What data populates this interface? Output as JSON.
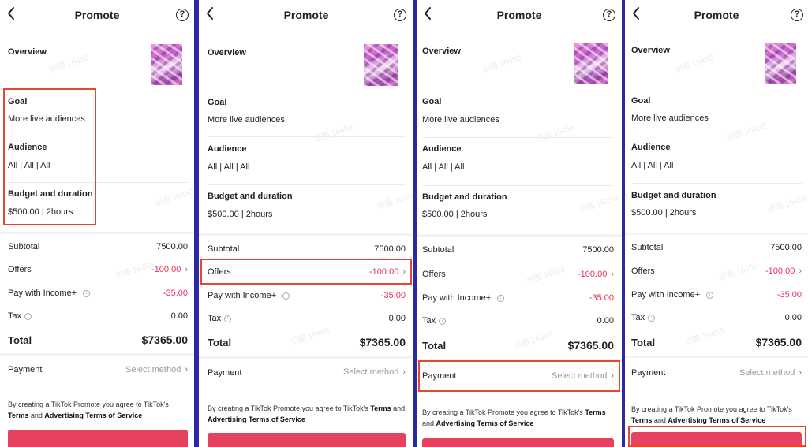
{
  "header": {
    "title": "Promote",
    "help_icon": "?"
  },
  "overview_label": "Overview",
  "goal": {
    "label": "Goal",
    "value": "More live audiences"
  },
  "audience": {
    "label": "Audience",
    "value": "All | All | All"
  },
  "budget": {
    "label": "Budget and duration",
    "value": "$500.00 | 2hours"
  },
  "summary": {
    "subtotal_label": "Subtotal",
    "subtotal_value": "7500.00",
    "offers_label": "Offers",
    "offers_value": "-100.00",
    "income_label": "Pay with Income+",
    "income_value": "-35.00",
    "tax_label": "Tax",
    "tax_value": "0.00",
    "total_label": "Total",
    "total_value": "$7365.00"
  },
  "payment": {
    "label": "Payment",
    "placeholder": "Select method"
  },
  "terms": {
    "prefix": "By creating a TikTok Promote you agree to TikTok's ",
    "terms_link": "Terms",
    "connector": " and ",
    "ad_terms_link": "Advertising Terms of Service"
  },
  "watermark": "识图 16458",
  "colors": {
    "accent": "#e6415f",
    "highlight": "#e8472f",
    "negative": "#e8315a",
    "divider_bg": "#2d2aa0"
  }
}
